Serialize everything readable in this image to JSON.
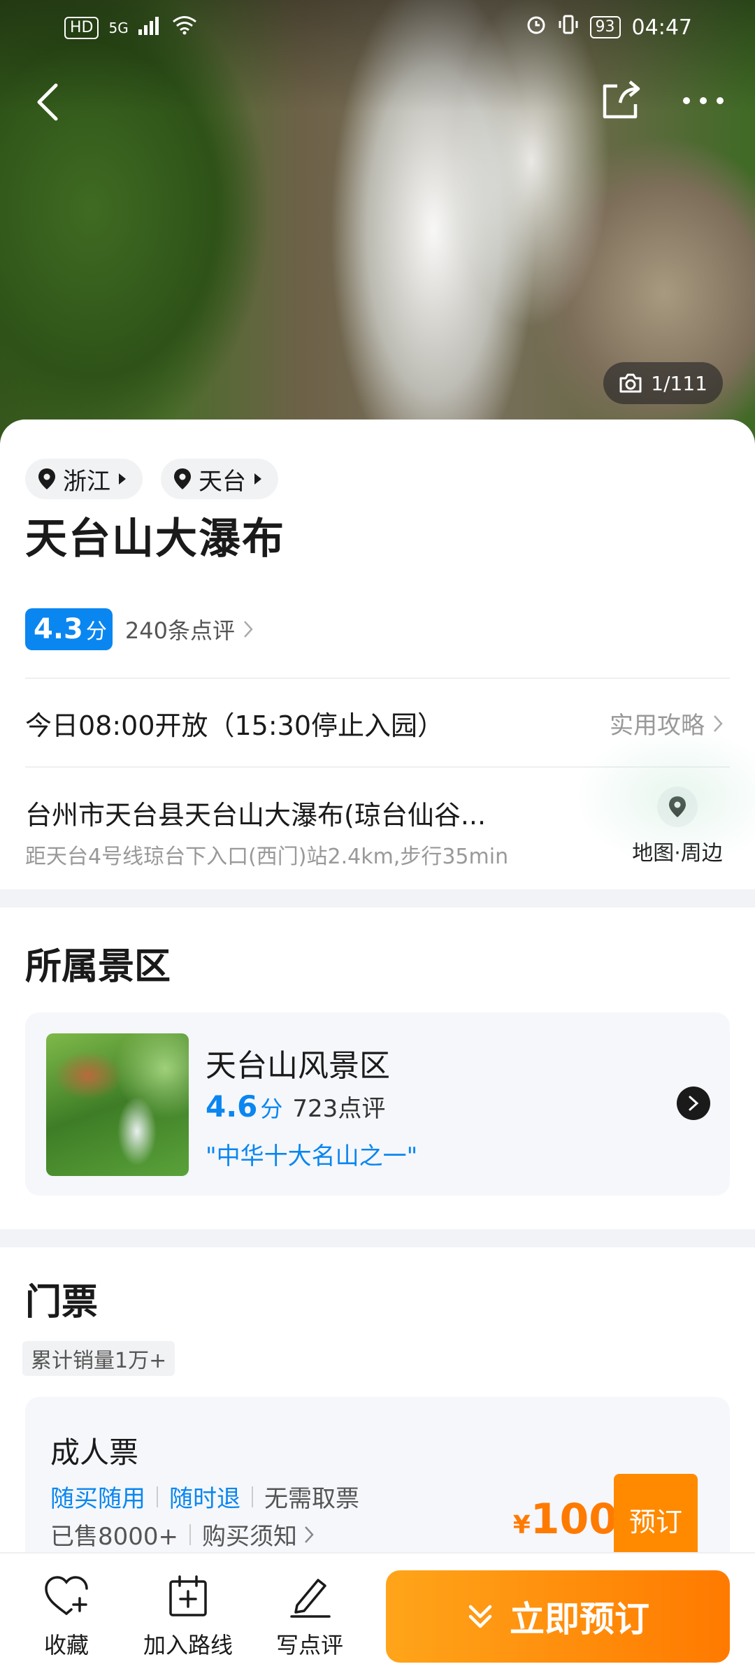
{
  "status_bar": {
    "hd": "HD",
    "network": "5G",
    "battery": "93",
    "time": "04:47"
  },
  "hero": {
    "photo_count": "1/111"
  },
  "location_tags": [
    {
      "label": "浙江"
    },
    {
      "label": "天台"
    }
  ],
  "poi": {
    "title": "天台山大瀑布",
    "score": "4.3",
    "score_unit": "分",
    "review_count": "240条点评",
    "hours": "今日08:00开放（15:30停止入园）",
    "guide_link": "实用攻略",
    "address": "台州市天台县天台山大瀑布(琼台仙谷...",
    "metro": "距天台4号线琼台下入口(西门)站2.4km,步行35min",
    "map_label": "地图·周边"
  },
  "scenic_section": {
    "title": "所属景区",
    "name": "天台山风景区",
    "score": "4.6",
    "score_unit": "分",
    "reviews": "723点评",
    "quote": "\"中华十大名山之一\""
  },
  "ticket_section": {
    "title": "门票",
    "sales": "累计销量1万+",
    "ticket": {
      "name": "成人票",
      "features": [
        "随买随用",
        "随时退",
        "无需取票"
      ],
      "sold": "已售8000+",
      "notice": "购买须知",
      "currency": "¥",
      "price": "100",
      "book_label": "预订"
    }
  },
  "bottom_bar": {
    "favorite": "收藏",
    "add_route": "加入路线",
    "write_review": "写点评",
    "book_now": "立即预订"
  },
  "colors": {
    "accent_blue": "#0a86f0",
    "accent_orange": "#ff7a00"
  }
}
